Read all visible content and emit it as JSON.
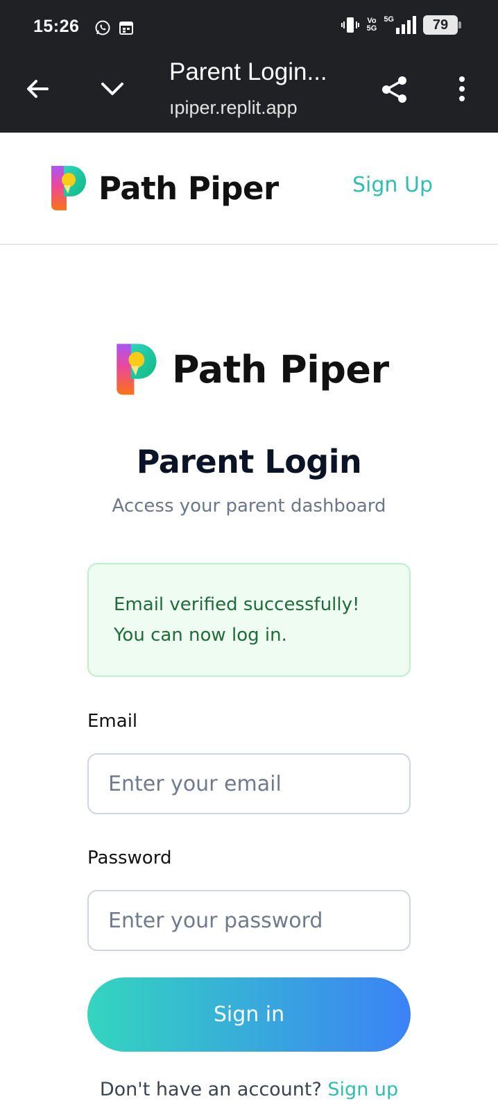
{
  "status_bar": {
    "time": "15:26",
    "volte_label": "Vo",
    "network_label_small": "5G",
    "network_label": "5G",
    "battery": "79"
  },
  "toolbar": {
    "title": "Parent Login...",
    "url": "ıpiper.replit.app"
  },
  "header": {
    "brand": "Path Piper",
    "signup_label": "Sign Up"
  },
  "login": {
    "brand": "Path Piper",
    "heading": "Parent Login",
    "subheading": "Access your parent dashboard",
    "alert_line1": "Email verified successfully!",
    "alert_line2": "You can now log in.",
    "email_label": "Email",
    "email_placeholder": "Enter your email",
    "email_value": "",
    "password_label": "Password",
    "password_placeholder": "Enter your password",
    "password_value": "",
    "signin_label": "Sign in",
    "footer_text": "Don't have an account?",
    "footer_link": "Sign up"
  },
  "colors": {
    "accent": "#2fbfae",
    "button_gradient_start": "#34d5bf",
    "button_gradient_end": "#3b82f6",
    "alert_bg": "#eefcf2",
    "alert_text": "#1f6b3a",
    "chrome_bg": "#202124"
  },
  "icons": [
    "whatsapp-icon",
    "calendar-icon",
    "vibrate-icon",
    "signal-icon",
    "back-arrow-icon",
    "chevron-down-icon",
    "share-icon",
    "more-vert-icon",
    "path-piper-logo"
  ]
}
